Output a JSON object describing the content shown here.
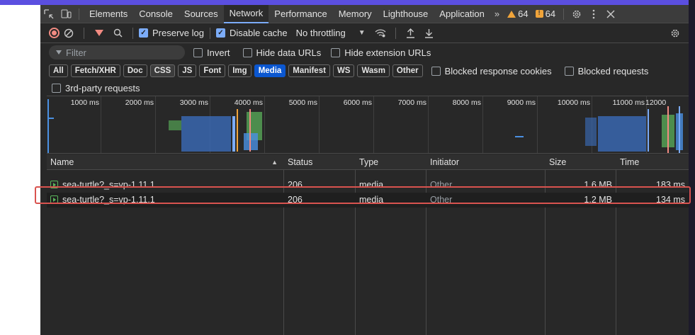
{
  "tabbar": {
    "tabs": [
      "Elements",
      "Console",
      "Sources",
      "Network",
      "Performance",
      "Memory",
      "Lighthouse",
      "Application"
    ],
    "active": "Network",
    "more": "»",
    "warnings": "64",
    "errors": "64"
  },
  "toolbar": {
    "preserve_log": "Preserve log",
    "disable_cache": "Disable cache",
    "throttling": "No throttling"
  },
  "filterbar": {
    "filter_placeholder": "Filter",
    "invert": "Invert",
    "hide_data_urls": "Hide data URLs",
    "hide_extension_urls": "Hide extension URLs"
  },
  "typebar": {
    "chips": [
      "All",
      "Fetch/XHR",
      "Doc",
      "CSS",
      "JS",
      "Font",
      "Img",
      "Media",
      "Manifest",
      "WS",
      "Wasm",
      "Other"
    ],
    "active": "Media",
    "blocked_cookies": "Blocked response cookies",
    "blocked_requests": "Blocked requests"
  },
  "thirdbar": {
    "third_party": "3rd-party requests"
  },
  "overview": {
    "ticks": [
      "1000 ms",
      "2000 ms",
      "3000 ms",
      "4000 ms",
      "5000 ms",
      "6000 ms",
      "7000 ms",
      "8000 ms",
      "9000 ms",
      "10000 ms",
      "11000 ms",
      "12000"
    ]
  },
  "table": {
    "headers": {
      "name": "Name",
      "status": "Status",
      "type": "Type",
      "initiator": "Initiator",
      "size": "Size",
      "time": "Time"
    },
    "sort_indicator": "▲",
    "rows": [
      {
        "name": "sea-turtle?_s=vp-1.11.1",
        "status": "206",
        "type": "media",
        "initiator": "Other",
        "size": "1.6 MB",
        "time": "183 ms"
      },
      {
        "name": "sea-turtle?_s=vp-1.11.1",
        "status": "206",
        "type": "media",
        "initiator": "Other",
        "size": "1.2 MB",
        "time": "134 ms"
      }
    ]
  }
}
